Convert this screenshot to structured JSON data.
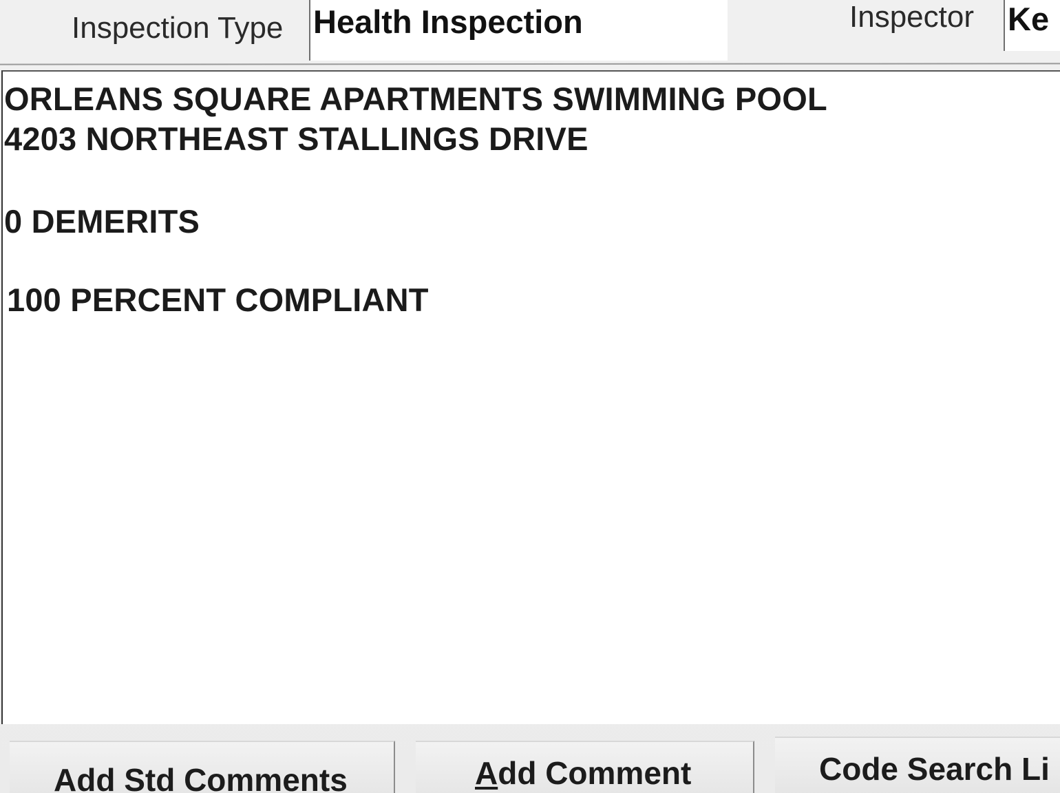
{
  "header": {
    "inspection_type_label": "Inspection Type",
    "inspection_type_value": "Health Inspection",
    "inspector_label": "Inspector",
    "inspector_value": "Ke"
  },
  "comments": {
    "lines": [
      "ORLEANS SQUARE APARTMENTS SWIMMING POOL",
      "4203 NORTHEAST STALLINGS DRIVE",
      "0 DEMERITS",
      "100 PERCENT COMPLIANT"
    ]
  },
  "buttons": {
    "add_std_comments": {
      "pre": "Add ",
      "mnemonic": "S",
      "post": "td Comments"
    },
    "add_comment": {
      "pre": "",
      "mnemonic": "A",
      "post": "dd Comment"
    },
    "code_search": {
      "label": "Code Search Li"
    }
  }
}
